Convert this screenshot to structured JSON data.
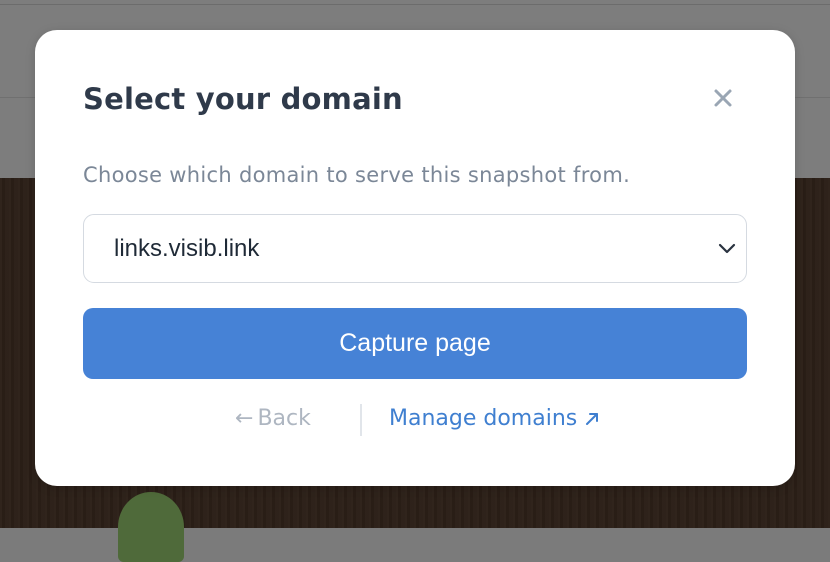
{
  "dialog": {
    "title": "Select your domain",
    "description": "Choose which domain to serve this snapshot from.",
    "close_icon": "close-icon"
  },
  "domain_select": {
    "selected": "links.visib.link",
    "icon": "chevron-down-icon"
  },
  "actions": {
    "capture_label": "Capture page",
    "back_arrow": "←",
    "back_label": "Back",
    "manage_label": "Manage domains",
    "manage_icon": "external-link-icon"
  },
  "colors": {
    "primary": "#4682d6",
    "link": "#3f7fd0",
    "title": "#2f3a4a",
    "muted": "#7b8797"
  }
}
